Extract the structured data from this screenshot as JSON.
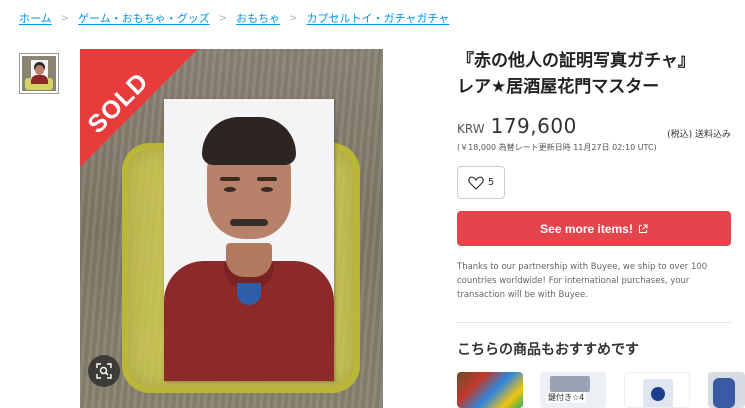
{
  "breadcrumb": {
    "items": [
      "ホーム",
      "ゲーム・おもちゃ・グッズ",
      "おもちゃ",
      "カプセルトイ・ガチャガチャ"
    ],
    "separator": ">"
  },
  "gallery": {
    "sold_label": "SOLD",
    "zoom_icon": "zoom-search-icon"
  },
  "product": {
    "title_line1": "『赤の他人の証明写真ガチャ』",
    "title_line2": "レア★居酒屋花門マスター",
    "currency": "KRW",
    "price": "179,600",
    "tax_note": "(税込) 送料込み",
    "rate_note": "(￥18,000 為替レート更新日時 11月27日 02:10 UTC)",
    "like_count": "5",
    "cta_label": "See more items!",
    "partner_text": "Thanks to our partnership with Buyee, we ship to over 100 countries worldwide! For international purchases, your transaction will be with Buyee."
  },
  "recommend": {
    "title": "こちらの商品もおすすめです",
    "item2_tag": "鍵付き☆4"
  },
  "colors": {
    "link": "#0095ee",
    "cta": "#e4454d",
    "sold": "#e83c3c"
  }
}
